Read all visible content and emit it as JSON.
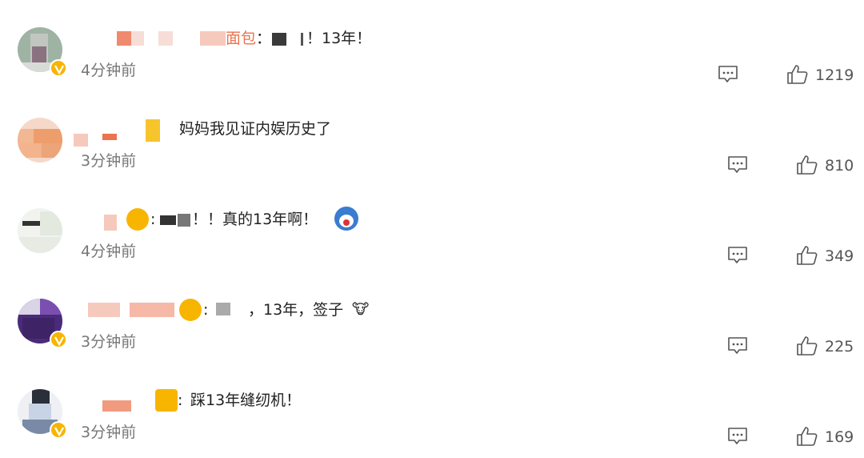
{
  "comments": [
    {
      "name_tail": "面包",
      "sep": "：",
      "content": "！13年！",
      "time": "4分钟前",
      "likes": "1219",
      "verified": true
    },
    {
      "content": "妈妈我见证内娱历史了",
      "time": "3分钟前",
      "likes": "810",
      "verified": false
    },
    {
      "content": "！！真的13年啊！",
      "time": "4分钟前",
      "likes": "349",
      "verified": false
    },
    {
      "content": "，13年，签子",
      "time": "3分钟前",
      "likes": "225",
      "verified": true
    },
    {
      "content": "踩13年缝纫机！",
      "time": "3分钟前",
      "likes": "169",
      "verified": true
    }
  ],
  "icons": {
    "reply": "comment-bubble-icon",
    "like": "thumbs-up-icon",
    "verified": "verified-v-badge-icon"
  },
  "colors": {
    "username": "#eb7350",
    "badge": "#f7b500",
    "time": "#777777"
  }
}
